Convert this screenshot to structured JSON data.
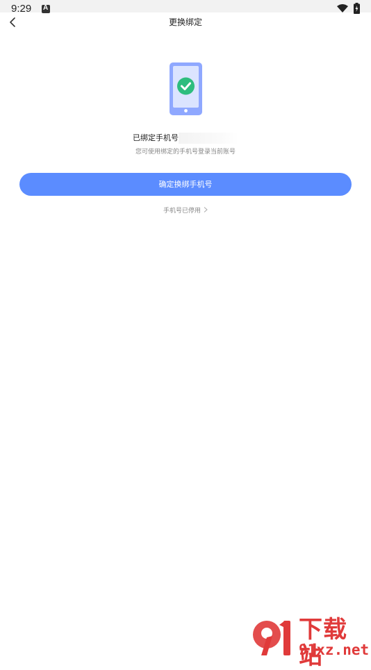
{
  "status_bar": {
    "time": "9:29",
    "icons": [
      "a-notification-icon",
      "wifi-icon",
      "battery-charging-icon"
    ]
  },
  "header": {
    "back_icon": "chevron-left-icon",
    "title": "更换绑定"
  },
  "main": {
    "illustration_icon": "phone-check-icon",
    "bound_label": "已绑定手机号",
    "bound_hint": "您可使用绑定的手机号登录当前账号",
    "confirm_button": "确定换绑手机号",
    "disabled_link": "手机号已停用",
    "disabled_link_icon": "chevron-right-icon"
  },
  "watermark": {
    "title": "下载站",
    "subtitle": "91xz.net"
  },
  "colors": {
    "accent": "#5b8cff",
    "phone_body": "#8fa8ff",
    "check": "#2dbd7e",
    "watermark": "#e03a3a"
  }
}
